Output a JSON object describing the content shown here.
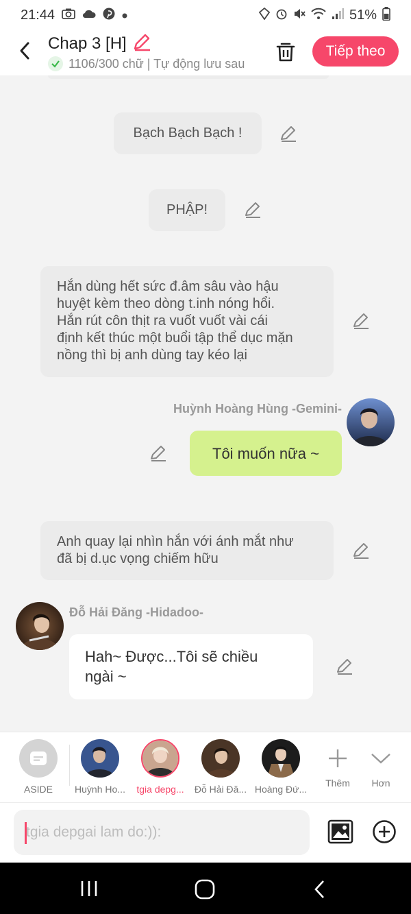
{
  "status": {
    "time": "21:44",
    "battery": "51%"
  },
  "header": {
    "title": "Chap 3 [H]",
    "subtitle": "1106/300 chữ | Tự động lưu sau",
    "next_label": "Tiếp theo"
  },
  "messages": {
    "m1": "Bạch Bạch Bạch !",
    "m2": "PHẬP!",
    "m3_lines": [
      "Hắn dùng hết sức đ.âm sâu vào hậu",
      "huyệt kèm theo dòng t.inh nóng hổi.",
      "Hắn rút côn thịt ra vuốt vuốt vài cái",
      "định kết thúc một buổi tập thể dục mặn",
      "nồng thì bị anh dùng tay kéo lại"
    ],
    "m4_sender": "Huỳnh Hoàng Hùng -Gemini-",
    "m4": "Tôi muốn nữa ~",
    "m5_lines": [
      "Anh quay lại nhìn hắn với ánh mắt như",
      "đã bị d.ục vọng chiếm hữu"
    ],
    "m6_sender": "Đỗ Hải Đăng -Hidadoo-",
    "m6_lines": [
      "Hah~ Được...Tôi sẽ chiều",
      "ngài ~"
    ]
  },
  "characters": [
    {
      "label": "ASIDE",
      "icon": "aside-icon"
    },
    {
      "label": "Huỳnh Ho...",
      "icon": "avatar"
    },
    {
      "label": "tgia depg...",
      "icon": "avatar",
      "active": true
    },
    {
      "label": "Đỗ Hải Đă...",
      "icon": "avatar"
    },
    {
      "label": "Hoàng Đứ...",
      "icon": "avatar"
    },
    {
      "label": "Thêm",
      "icon": "plus-icon"
    },
    {
      "label": "Hơn",
      "icon": "chevron-down-icon"
    }
  ],
  "input": {
    "placeholder": "tgia depgai lam do:)):"
  },
  "colors": {
    "accent": "#f6476a",
    "green_bubble": "#d5f18e",
    "gray_bubble": "#ebebeb"
  }
}
